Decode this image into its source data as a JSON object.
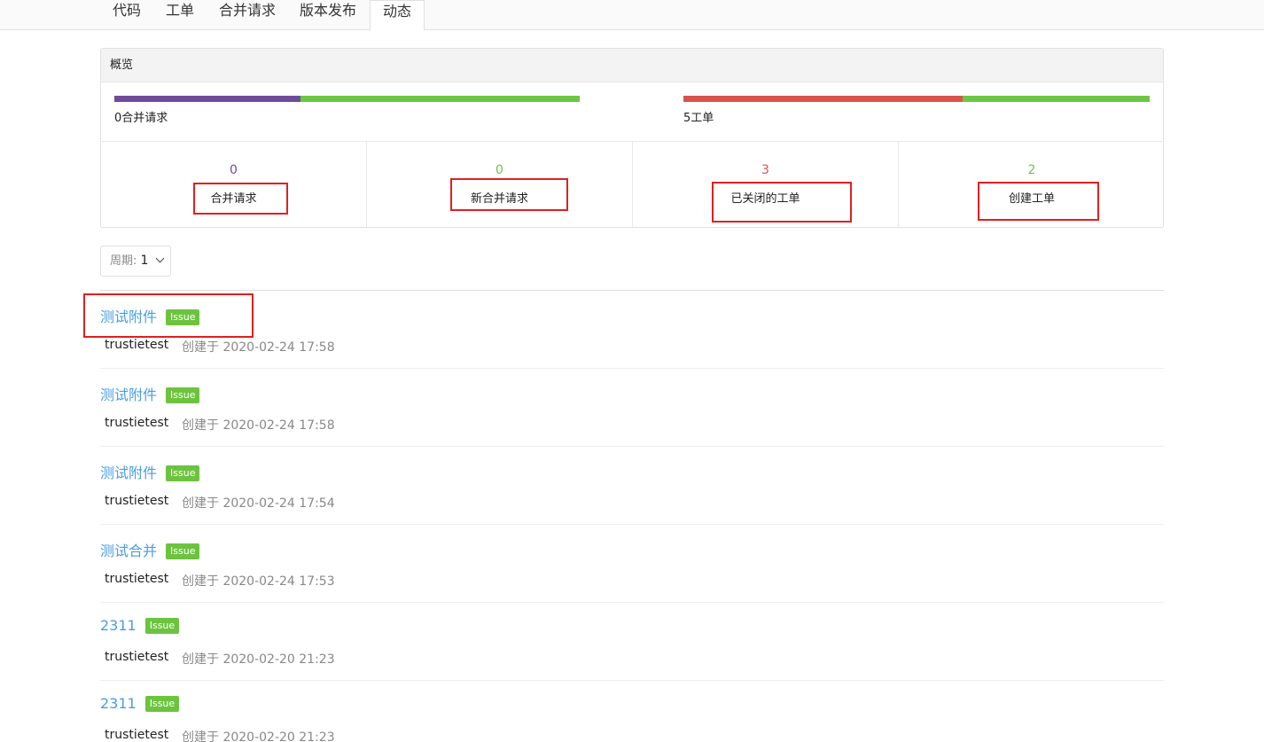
{
  "tabs": [
    {
      "label": "代码"
    },
    {
      "label": "工单"
    },
    {
      "label": "合并请求"
    },
    {
      "label": "版本发布"
    },
    {
      "label": "动态",
      "active": true
    }
  ],
  "overview": {
    "title": "概览",
    "merge_bar": {
      "label": "0合并请求",
      "segments": [
        {
          "color": "#6f4c9b",
          "fraction": 0.4
        },
        {
          "color": "#6cc644",
          "fraction": 0.6
        }
      ]
    },
    "issue_bar": {
      "label": "5工单",
      "segments": [
        {
          "color": "#d9534f",
          "fraction": 0.6
        },
        {
          "color": "#6cc644",
          "fraction": 0.4
        }
      ]
    },
    "stats": [
      {
        "value": "0",
        "label": "合并请求",
        "color": "#6f4c9b"
      },
      {
        "value": "0",
        "label": "新合并请求",
        "color": "#6cc644"
      },
      {
        "value": "3",
        "label": "已关闭的工单",
        "color": "#d9534f"
      },
      {
        "value": "2",
        "label": "创建工单",
        "color": "#6cc644"
      }
    ]
  },
  "period": {
    "label": "周期:",
    "value": "1"
  },
  "activities": [
    {
      "title": "测试附件",
      "badge": "Issue",
      "author": "trustietest",
      "meta": "创建于 2020-02-24 17:58"
    },
    {
      "title": "测试附件",
      "badge": "Issue",
      "author": "trustietest",
      "meta": "创建于 2020-02-24 17:58"
    },
    {
      "title": "测试附件",
      "badge": "Issue",
      "author": "trustietest",
      "meta": "创建于 2020-02-24 17:54"
    },
    {
      "title": "测试合并",
      "badge": "Issue",
      "author": "trustietest",
      "meta": "创建于 2020-02-24 17:53"
    },
    {
      "title": "2311",
      "badge": "Issue",
      "author": "trustietest",
      "meta": "创建于 2020-02-20 21:23"
    },
    {
      "title": "2311",
      "badge": "Issue",
      "author": "trustietest",
      "meta": "创建于 2020-02-20 21:23"
    }
  ]
}
